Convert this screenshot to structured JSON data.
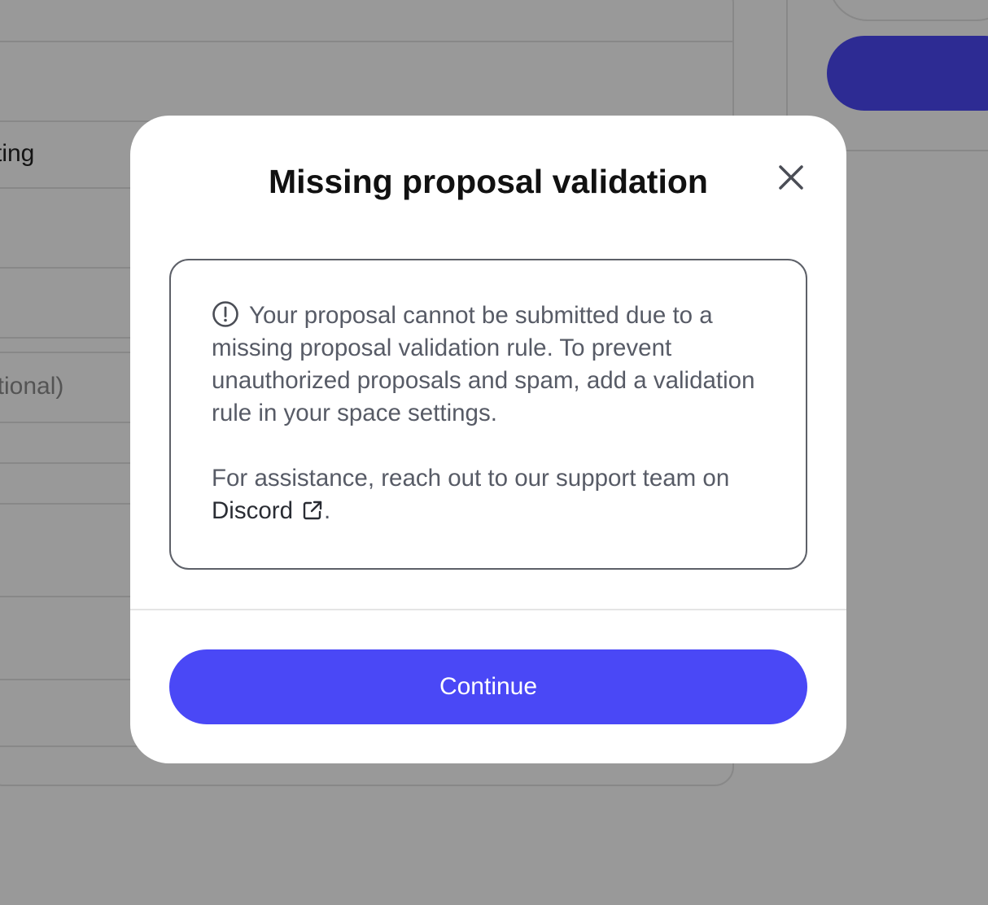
{
  "background": {
    "field_label_1": "ting",
    "field_label_2": "ptional)"
  },
  "modal": {
    "title": "Missing proposal validation",
    "close_icon": "close-icon",
    "notice": {
      "icon": "info-circle-icon",
      "paragraph_1": "Your proposal cannot be submitted due to a missing proposal validation rule. To prevent unauthorized proposals and spam, add a validation rule in your space settings.",
      "paragraph_2_prefix": "For assistance, reach out to our support team on ",
      "link_label": "Discord",
      "link_icon": "external-link-icon",
      "paragraph_2_suffix": "."
    },
    "continue_label": "Continue"
  },
  "colors": {
    "primary": "#4a48f6",
    "overlay": "rgba(0,0,0,0.4)",
    "text_muted": "#575b66"
  }
}
